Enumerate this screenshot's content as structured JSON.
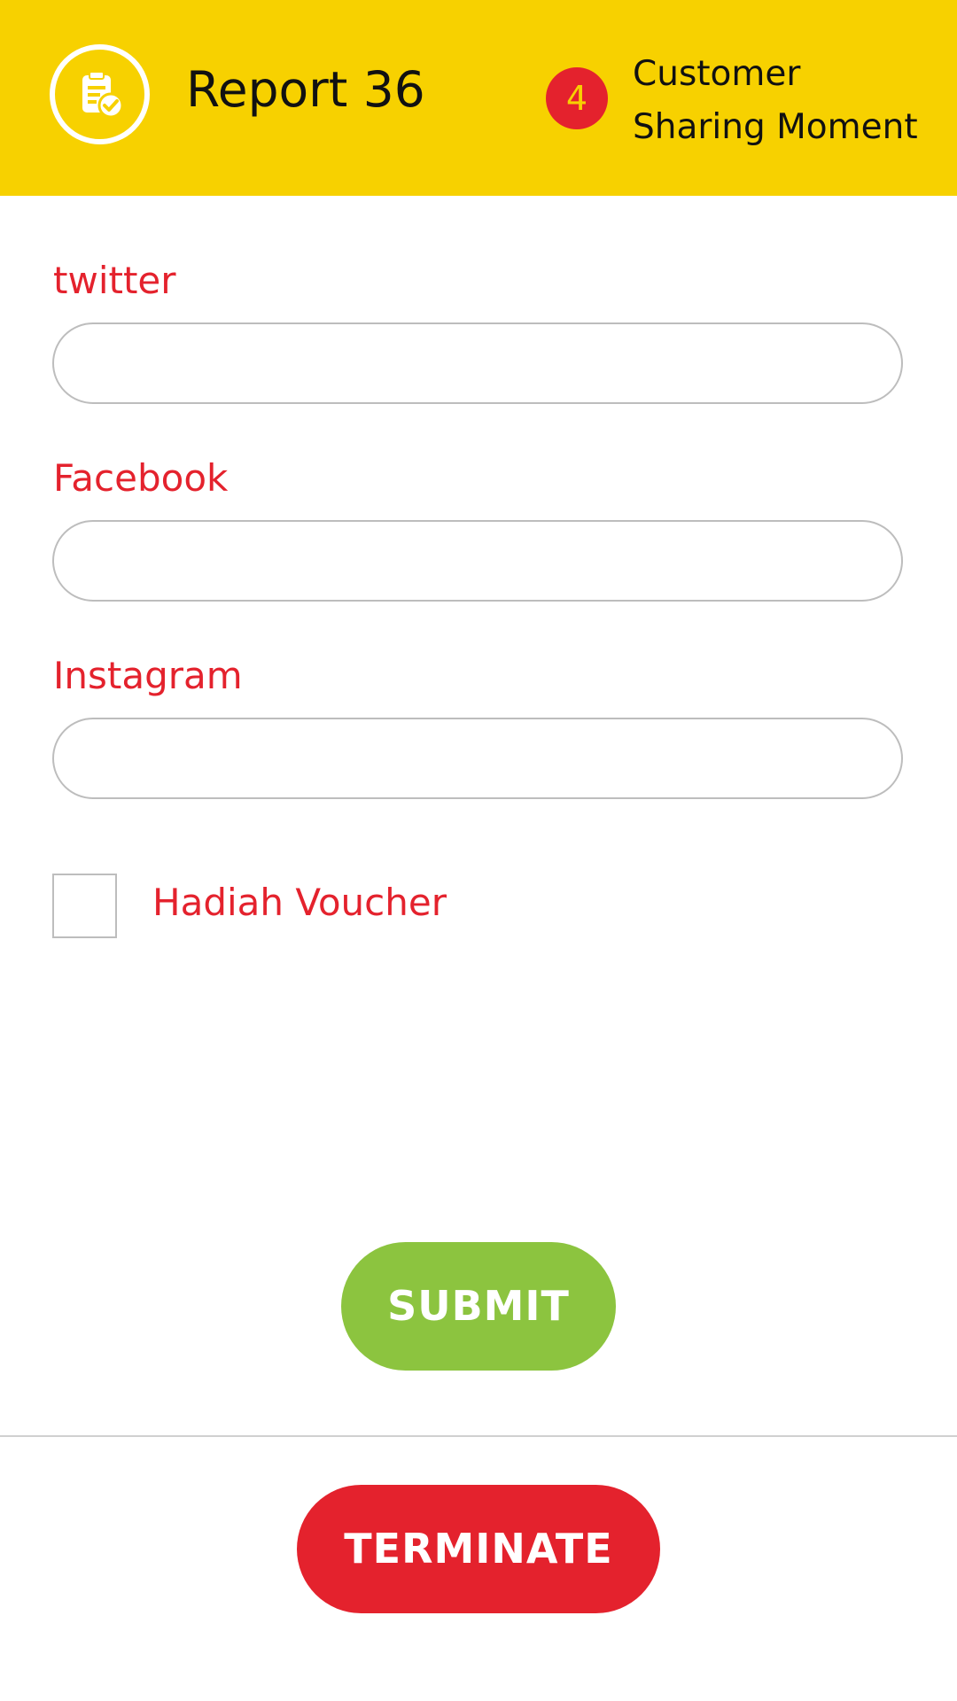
{
  "header": {
    "title": "Report 36",
    "icon": "report-check-icon",
    "step_number": "4",
    "step_name": "Customer Sharing Moment"
  },
  "form": {
    "fields": [
      {
        "label": "twitter",
        "value": "",
        "placeholder": ""
      },
      {
        "label": "Facebook",
        "value": "",
        "placeholder": ""
      },
      {
        "label": "Instagram",
        "value": "",
        "placeholder": ""
      }
    ],
    "checkbox": {
      "label": "Hadiah Voucher",
      "checked": false
    }
  },
  "actions": {
    "submit_label": "SUBMIT",
    "terminate_label": "TERMINATE"
  },
  "colors": {
    "header_bg": "#F7D100",
    "accent_red": "#E4222D",
    "submit_green": "#8CC43F"
  }
}
